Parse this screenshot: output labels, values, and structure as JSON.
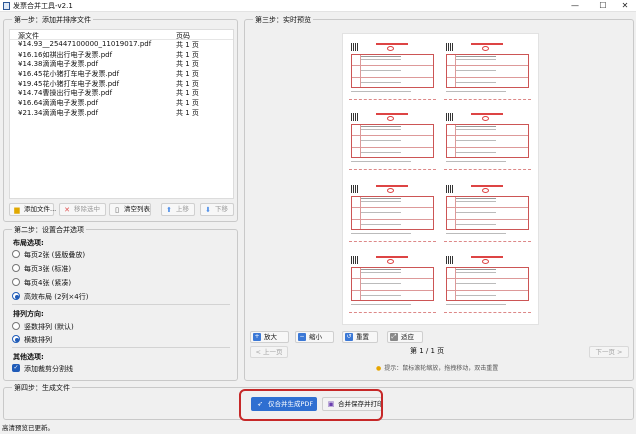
{
  "window": {
    "title": "发票合并工具-v2.1",
    "min": "—",
    "max": "☐",
    "close": "✕"
  },
  "step1": {
    "title": "第一步：添加并排序文件",
    "columns": {
      "file": "源文件",
      "pages": "页码"
    },
    "files": [
      {
        "name": "¥14.93__25447100000_11019017.pdf",
        "pages": "共 1 页"
      },
      {
        "name": "¥16.16如祺出行电子发票.pdf",
        "pages": "共 1 页"
      },
      {
        "name": "¥14.38滴滴电子发票.pdf",
        "pages": "共 1 页"
      },
      {
        "name": "¥16.45花小猪打车电子发票.pdf",
        "pages": "共 1 页"
      },
      {
        "name": "¥19.45花小猪打车电子发票.pdf",
        "pages": "共 1 页"
      },
      {
        "name": "¥14.74曹操出行电子发票.pdf",
        "pages": "共 1 页"
      },
      {
        "name": "¥16.64滴滴电子发票.pdf",
        "pages": "共 1 页"
      },
      {
        "name": "¥21.34滴滴电子发票.pdf",
        "pages": "共 1 页"
      }
    ],
    "buttons": {
      "add": "添加文件...",
      "remove": "移除选中",
      "clear": "清空列表",
      "up": "上移",
      "down": "下移"
    }
  },
  "step2": {
    "title": "第二步：设置合并选项",
    "layout_label": "布局选项:",
    "layout_options": [
      "每页2张 (竖版叠放)",
      "每页3张 (标准)",
      "每页4张 (紧凑)",
      "高效布局 (2列×4行)"
    ],
    "layout_selected": 3,
    "order_label": "排列方向:",
    "order_options": [
      "竖数排列 (默认)",
      "横数排列"
    ],
    "order_selected": 1,
    "other_label": "其他选项:",
    "other_option": "添加裁剪分割线",
    "other_checked": true
  },
  "step3": {
    "title": "第三步：实时预览",
    "controls": {
      "zoom_in": "放大",
      "zoom_out": "缩小",
      "reset": "重置",
      "fit": "适应"
    },
    "prev": "< 上一页",
    "next": "下一页 >",
    "page_info": "第 1 / 1 页",
    "hint": "提示：鼠标滚轮缩放，拖拽移动，双击重置"
  },
  "step4": {
    "title": "第四步：生成文件",
    "gen_button": "仅合并生成PDF",
    "print_button": "合并保存并打印"
  },
  "status": "高清预览已更新。",
  "colors": {
    "accent": "#2f6fd1",
    "highlight": "#c62828",
    "invoice_red": "#d44444"
  }
}
